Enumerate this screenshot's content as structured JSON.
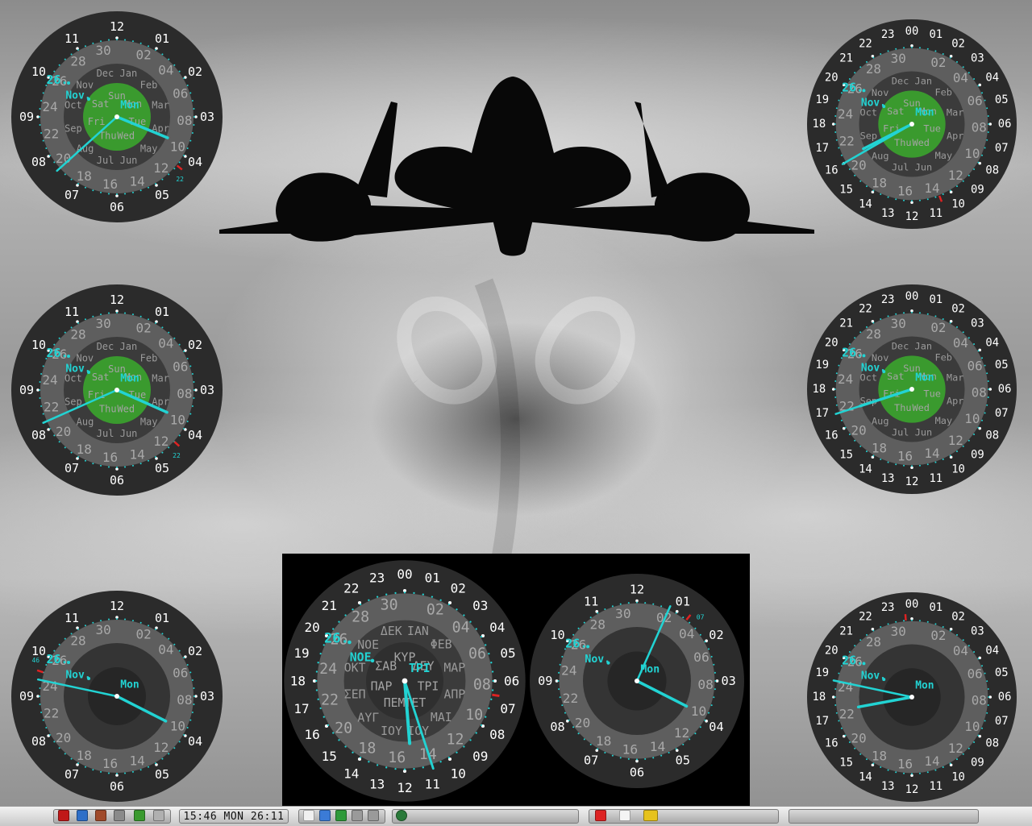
{
  "desktop": {
    "wallpaper": "cloud-vortex-with-aircraft-silhouette",
    "colors": {
      "accent": "#22d3d3",
      "dial_dark": "#2b2b2b",
      "ring_grey": "#5e5e5e",
      "ring_light": "#8a8a8a",
      "center_green": "#3a9a2e",
      "alarm_red": "#dd2222"
    }
  },
  "months_en": [
    "Jan",
    "Feb",
    "Mar",
    "Apr",
    "May",
    "Jun",
    "Jul",
    "Aug",
    "Sep",
    "Oct",
    "Nov",
    "Dec"
  ],
  "days_en": [
    "Sun",
    "Mon",
    "Tue",
    "Wed",
    "Thu",
    "Fri",
    "Sat"
  ],
  "months_gr": [
    "ΙΑΝ",
    "ΦΕΒ",
    "ΜΑΡ",
    "ΑΠΡ",
    "ΜΑΙ",
    "ΙΟΥ",
    "ΙΟΥ",
    "ΑΥΓ",
    "ΣΕΠ",
    "ΟΚΤ",
    "ΝΟΕ",
    "ΔΕΚ"
  ],
  "days_gr": [
    "ΚΥΡ",
    "ΔΕΥ",
    "ΤΡΙ",
    "ΤΕΤ",
    "ΠΕΜ",
    "ΠΑΡ",
    "ΣΑΒ"
  ],
  "clocks": [
    {
      "id": "clock-1",
      "type": "12",
      "months": true,
      "green": true,
      "weekday": "Mon",
      "month_label": "Nov.",
      "day_label": "26.",
      "alarm_label": "22",
      "alarm_hour": 4.3,
      "hour_hand": 3.75,
      "minute_hand": 38
    },
    {
      "id": "clock-2",
      "type": "24",
      "months": true,
      "green": true,
      "weekday": "Mon",
      "month_label": "Nov.",
      "day_label": "26.",
      "alarm_label": "",
      "alarm_hour": 10.6,
      "hour_hand": 16.2,
      "minute_hand": 40
    },
    {
      "id": "clock-3",
      "type": "12",
      "months": true,
      "green": true,
      "weekday": "Mon",
      "month_label": "Nov.",
      "day_label": "26.",
      "alarm_label": "22",
      "alarm_hour": 4.4,
      "hour_hand": 3.8,
      "minute_hand": 41
    },
    {
      "id": "clock-4",
      "type": "24",
      "months": true,
      "green": true,
      "weekday": "Mon",
      "month_label": "Nov.",
      "day_label": "26.",
      "alarm_label": "",
      "alarm_hour": -1,
      "hour_hand": 16.8,
      "minute_hand": 42
    },
    {
      "id": "clock-5",
      "type": "12",
      "months": false,
      "green": false,
      "weekday": "Mon",
      "month_label": "Nov.",
      "day_label": "26.",
      "alarm_label": "46",
      "alarm_hour": 9.6,
      "hour_hand": 3.9,
      "minute_hand": 47
    },
    {
      "id": "clock-6",
      "type": "24",
      "months": false,
      "green": false,
      "weekday": "Mon",
      "month_label": "Nov.",
      "day_label": "26.",
      "alarm_label": "",
      "alarm_hour": 23.7,
      "hour_hand": 17.3,
      "minute_hand": 47
    },
    {
      "id": "clock-7",
      "type": "24",
      "months": true,
      "green": false,
      "greek": true,
      "weekday": "ΤΡΙ",
      "month_label": "ΝΟΕ",
      "day_label": "26.",
      "alarm_label": "",
      "alarm_hour": 6.6,
      "hour_hand": 11.7,
      "minute_hand": 27
    },
    {
      "id": "clock-8",
      "type": "12",
      "months": false,
      "green": false,
      "weekday": "Mon",
      "month_label": "Nov.",
      "day_label": "26.",
      "alarm_label": "07",
      "alarm_hour": 1.3,
      "hour_hand": 3.9,
      "minute_hand": 4
    }
  ],
  "taskbar": {
    "clock_text": "15:46  MON  26:11",
    "launchers": [
      "terminal-icon",
      "browser-icon",
      "printer-icon",
      "network-icon",
      "package-icon",
      "editor-icon"
    ],
    "tray": [
      "manual-icon",
      "dropbox-icon",
      "update-icon",
      "wifi-icon",
      "volume-icon"
    ],
    "apps": [
      "pen-icon",
      "font-icon",
      "folder-icon"
    ],
    "task_button_icon": "app-icon"
  }
}
